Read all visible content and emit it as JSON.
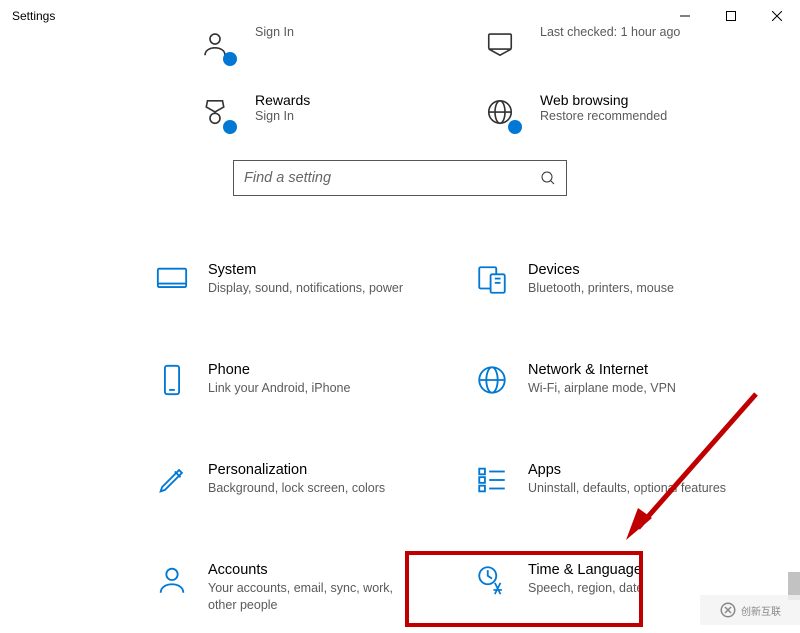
{
  "window": {
    "title": "Settings"
  },
  "status": {
    "row1": {
      "left": {
        "title": "",
        "sub": "Sign In"
      },
      "right": {
        "title": "",
        "sub": "Last checked: 1 hour ago"
      }
    },
    "row2": {
      "left": {
        "title": "Rewards",
        "sub": "Sign In"
      },
      "right": {
        "title": "Web browsing",
        "sub": "Restore recommended"
      }
    }
  },
  "search": {
    "placeholder": "Find a setting"
  },
  "categories": [
    {
      "key": "system",
      "title": "System",
      "sub": "Display, sound, notifications, power"
    },
    {
      "key": "devices",
      "title": "Devices",
      "sub": "Bluetooth, printers, mouse"
    },
    {
      "key": "phone",
      "title": "Phone",
      "sub": "Link your Android, iPhone"
    },
    {
      "key": "network",
      "title": "Network & Internet",
      "sub": "Wi-Fi, airplane mode, VPN"
    },
    {
      "key": "personalization",
      "title": "Personalization",
      "sub": "Background, lock screen, colors"
    },
    {
      "key": "apps",
      "title": "Apps",
      "sub": "Uninstall, defaults, optional features"
    },
    {
      "key": "accounts",
      "title": "Accounts",
      "sub": "Your accounts, email, sync, work, other people"
    },
    {
      "key": "time-language",
      "title": "Time & Language",
      "sub": "Speech, region, date"
    }
  ],
  "annotations": {
    "highlight_target": "time-language",
    "highlight_color": "#c00000"
  },
  "watermark": {
    "text": "创新互联"
  }
}
